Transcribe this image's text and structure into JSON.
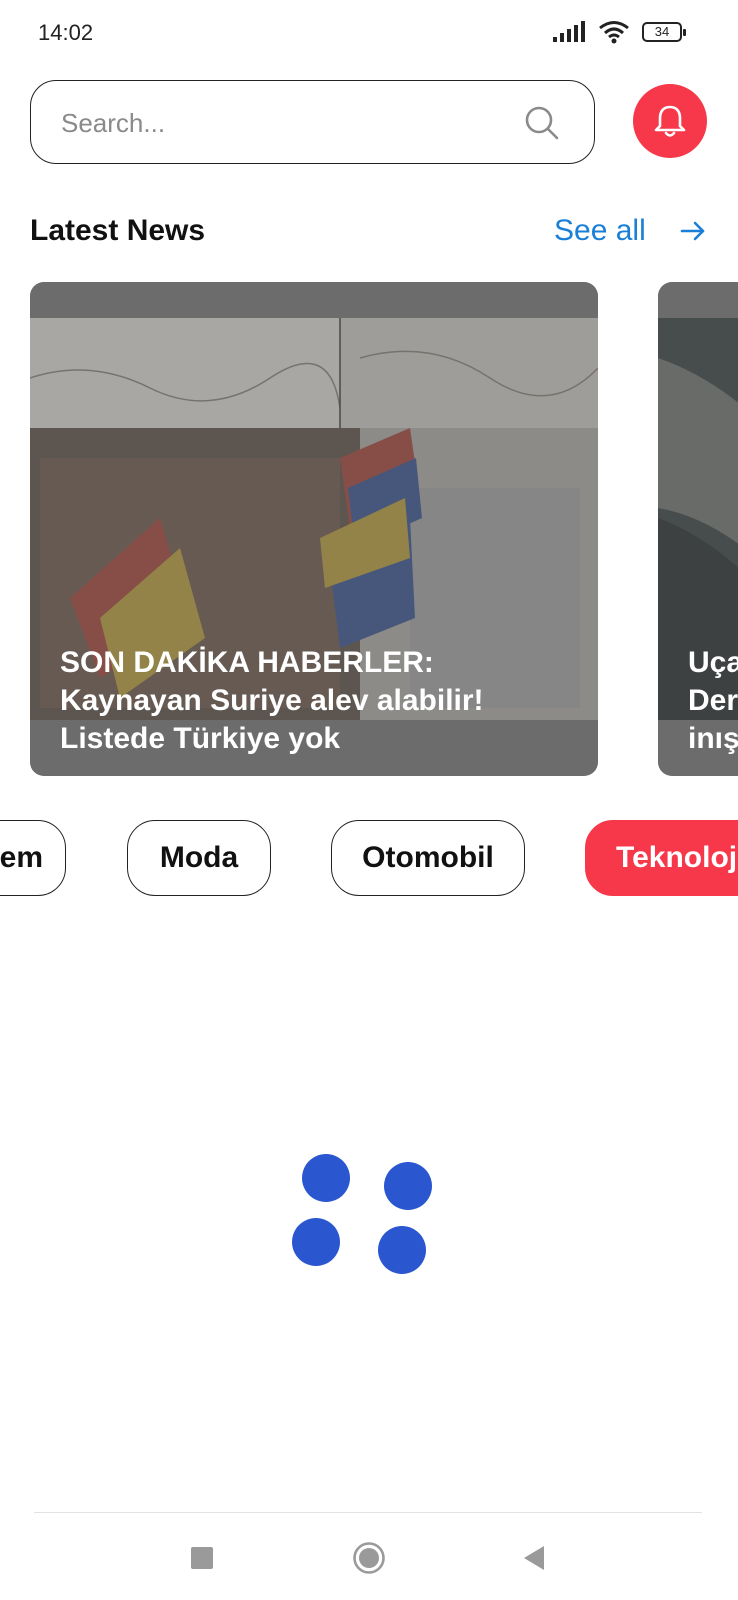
{
  "status_bar": {
    "time": "14:02",
    "battery": "34"
  },
  "search": {
    "placeholder": "Search..."
  },
  "latest_news": {
    "title": "Latest News",
    "see_all": "See all",
    "cards": [
      {
        "title": "SON DAKİKA HABERLER:\nKaynayan Suriye alev alabilir!\nListede Türkiye yok"
      },
      {
        "title": "Uça\nDer\ninış"
      }
    ]
  },
  "categories": [
    {
      "label": "em"
    },
    {
      "label": "Moda"
    },
    {
      "label": "Otomobil"
    },
    {
      "label": "Teknoloj",
      "active": true
    }
  ],
  "colors": {
    "accent": "#f6384a",
    "link": "#1a7fd6",
    "loader": "#2a56cf"
  },
  "icons": {
    "search": "search-icon",
    "bell": "bell-icon",
    "see_all": "arrow-right-icon",
    "nav_recents": "square-icon",
    "nav_home": "circle-icon",
    "nav_back": "triangle-back-icon"
  }
}
